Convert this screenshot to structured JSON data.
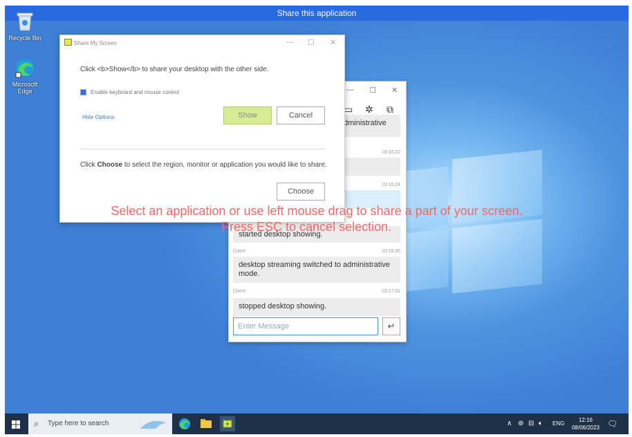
{
  "topbar": {
    "title": "Share this application"
  },
  "desktop": {
    "icons": [
      {
        "label": "Recycle Bin"
      },
      {
        "label": "Microsoft Edge"
      }
    ]
  },
  "share_dialog": {
    "title": "Share My Screen",
    "instruction": "Click <b>Show</b> to share your desktop with the other side.",
    "enable_control_label": "Enable keyboard and mouse control",
    "hide_options_label": "Hide Options",
    "show_label": "Show",
    "cancel_label": "Cancel",
    "choose_instruction_pre": "Click ",
    "choose_instruction_bold": "Choose",
    "choose_instruction_post": " to select the region, monitor or application you would like to share.",
    "choose_label": "Choose"
  },
  "overlay": {
    "line1": "Select an application or use left mouse drag to share a part of your screen.",
    "line2": "Press ESC to cancel selection."
  },
  "chat": {
    "partial_text": "dministrative",
    "messages": [
      {
        "sender": "",
        "time": "10:16:22",
        "text": ""
      },
      {
        "sender": "",
        "time": "10:16:24",
        "text": ""
      },
      {
        "sender": "",
        "time": "",
        "text": "started desktop showing."
      },
      {
        "sender": "Client",
        "time": "10:16:35",
        "text": "desktop streaming switched to administrative mode."
      },
      {
        "sender": "Client",
        "time": "10:17:01",
        "text": "stopped desktop showing."
      }
    ],
    "input_placeholder": "Enter Message",
    "send_icon": "↵"
  },
  "taskbar": {
    "search_placeholder": "Type here to search",
    "lang": "ENG",
    "time": "12:16",
    "date": "08/06/2023"
  },
  "colors": {
    "show_button": "#d6ec92",
    "topbar": "#2a6ae0",
    "overlay_text": "#f06868",
    "taskbar": "#1e3148"
  }
}
